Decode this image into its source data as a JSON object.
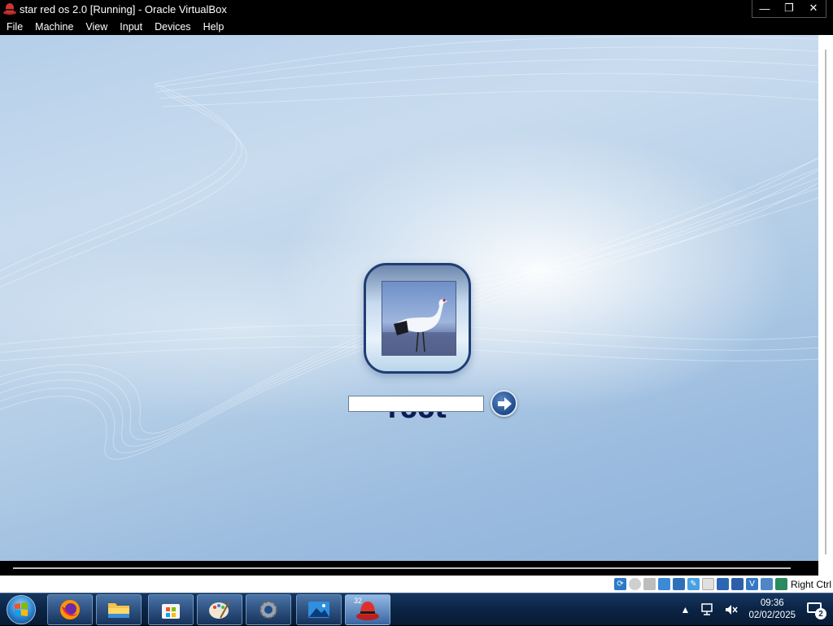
{
  "window": {
    "title": "star red os 2.0 [Running] - Oracle VirtualBox",
    "app_icon": "red-hat-icon",
    "controls": {
      "minimize": "—",
      "restore": "❐",
      "close": "✕"
    }
  },
  "menu": {
    "items": [
      {
        "label": "File"
      },
      {
        "label": "Machine"
      },
      {
        "label": "View"
      },
      {
        "label": "Input"
      },
      {
        "label": "Devices"
      },
      {
        "label": "Help"
      }
    ]
  },
  "login": {
    "username": "root",
    "password_value": "",
    "avatar": "crane-photo",
    "submit_icon": "arrow-right-icon"
  },
  "statusbar": {
    "host_key_label": "Right Ctrl",
    "icons": [
      "disk-icon",
      "optical-drive-icon",
      "floppy-icon",
      "audio-icon",
      "network-icon",
      "usb-icon",
      "shared-folders-icon",
      "display-icon",
      "video-capture-icon",
      "cpu-icon",
      "mouse-integration-icon",
      "keyboard-icon"
    ]
  },
  "taskbar": {
    "apps": [
      {
        "name": "firefox",
        "icon": "firefox-icon"
      },
      {
        "name": "file-explorer",
        "icon": "folder-icon"
      },
      {
        "name": "microsoft-store",
        "icon": "store-icon"
      },
      {
        "name": "paint",
        "icon": "palette-icon"
      },
      {
        "name": "settings",
        "icon": "gear-icon"
      },
      {
        "name": "photos",
        "icon": "photos-icon"
      },
      {
        "name": "virtualbox-vm",
        "icon": "red-hat-icon",
        "badge": "32"
      }
    ],
    "tray": {
      "time": "09:36",
      "date": "02/02/2025",
      "notification_count": "2"
    }
  },
  "colors": {
    "titlebar_bg": "#000000",
    "username_color": "#0e1c55",
    "taskbar_bg": "#0b2445"
  }
}
